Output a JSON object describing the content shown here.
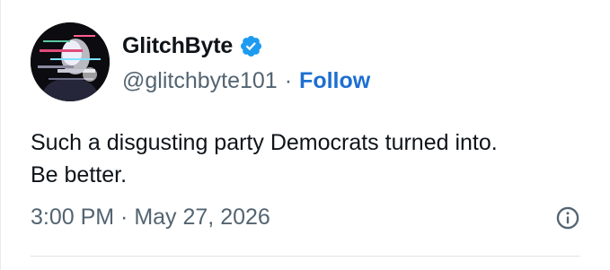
{
  "user": {
    "display_name": "GlitchByte",
    "handle": "@glitchbyte101",
    "separator": "·",
    "follow_label": "Follow",
    "verified_icon": "verified-badge-icon",
    "avatar_icon": "glitch-avatar-image"
  },
  "tweet": {
    "text_line1": "Such a disgusting party Democrats turned into.",
    "text_line2": "Be better."
  },
  "footer": {
    "timestamp": "3:00 PM · May 27, 2026",
    "info_icon": "info-icon"
  },
  "colors": {
    "accent": "#1d6fd1",
    "verified": "#1d9bf0",
    "text_primary": "#0f1419",
    "text_secondary": "#536471"
  }
}
